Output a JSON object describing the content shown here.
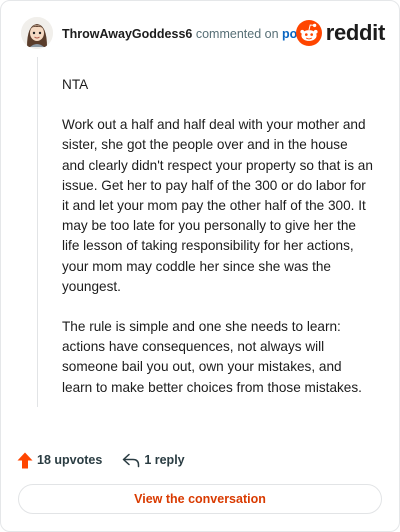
{
  "header": {
    "username": "ThrowAwayGoddess6",
    "action_text": "commented on",
    "post_link": "post",
    "brand": "reddit"
  },
  "comment": {
    "paragraphs": [
      "NTA",
      "Work out a half and half deal with your mother and sister, she got the people over and in the house and clearly didn't respect your property so that is an issue. Get her to pay half of the 300 or do labor for it and let your mom pay the other half of the 300. It may be too late for you personally to give her the life lesson of taking responsibility for her actions, your mom may coddle her since she was the youngest.",
      "The rule is simple and one she needs to learn: actions have consequences, not always will someone bail you out, own your mistakes, and learn to make better choices from those mistakes."
    ]
  },
  "actions": {
    "upvotes": "18 upvotes",
    "replies": "1 reply"
  },
  "cta": {
    "label": "View the conversation"
  },
  "colors": {
    "accent": "#d93a00",
    "upvote": "#ff4500",
    "link": "#0a66c2"
  },
  "icons": {
    "avatar": "user-avatar",
    "brand": "reddit-logo-icon",
    "upvote": "upvote-arrow-icon",
    "reply": "reply-arrow-icon"
  }
}
